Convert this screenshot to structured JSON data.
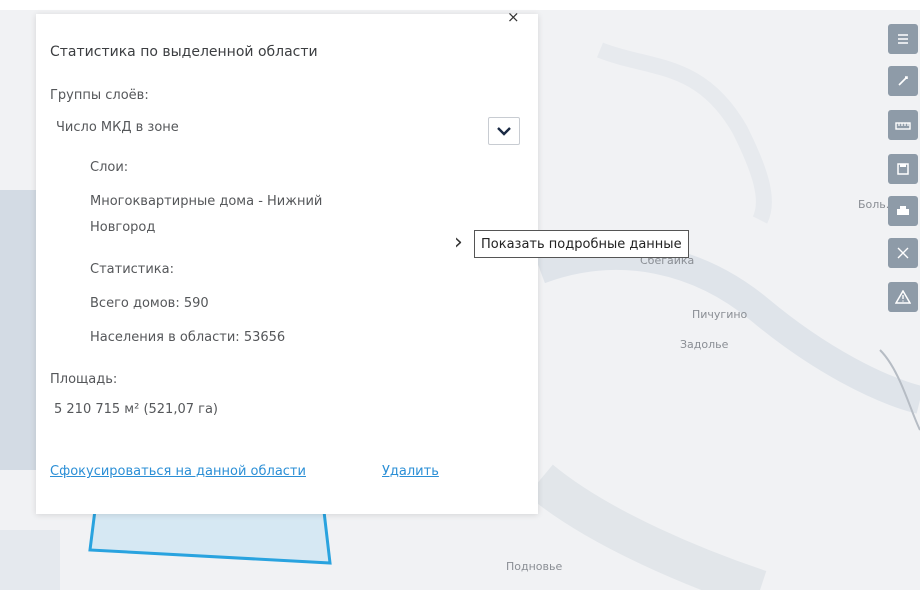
{
  "panel": {
    "title": "Статистика по выделенной области",
    "layer_groups_label": "Группы слоёв:",
    "layer_group_value": "Число МКД в зоне",
    "layers_label": "Слои:",
    "layer_name_line1": "Многоквартирные дома - Нижний",
    "layer_name_line2": "Новгород",
    "stats_label": "Статистика:",
    "total_houses": "Всего домов: 590",
    "population": "Населения в области: 53656",
    "area_label": "Площадь:",
    "area_value": "5 210 715 м² (521,07 га)",
    "focus_link": "Сфокусироваться на данной области",
    "delete_link": "Удалить",
    "close_symbol": "×"
  },
  "details": {
    "arrow_symbol": "›",
    "tooltip": "Показать подробные данные"
  },
  "map_labels": {
    "label_1": "Пичугино",
    "label_2": "Задолье",
    "label_3": "Подновье",
    "label_4": "Сбегайка",
    "label_5": "Боль..."
  },
  "toolbar": {
    "icons": [
      "layers-icon",
      "draw-icon",
      "measure-icon",
      "save-icon",
      "print-icon",
      "select-area-icon",
      "warning-icon"
    ]
  },
  "colors": {
    "link": "#2b8fd6",
    "selection": "#29a3df",
    "toolbar": "#8e9ba8"
  }
}
